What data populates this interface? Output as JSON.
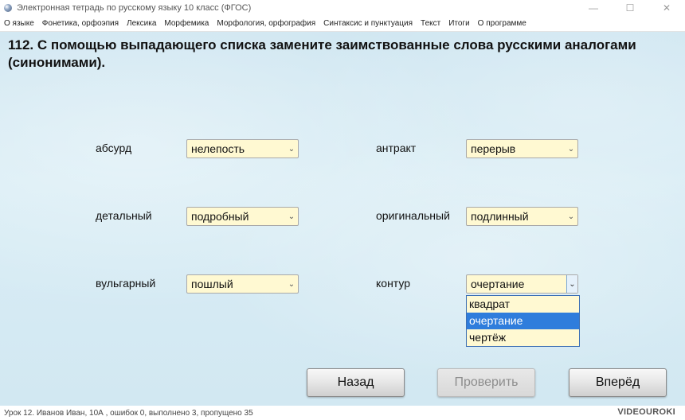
{
  "window": {
    "title": "Электронная тетрадь по русскому языку 10 класс (ФГОС)",
    "minimize": "—",
    "maximize": "☐",
    "close": "✕"
  },
  "menu": [
    "О языке",
    "Фонетика, орфоэпия",
    "Лексика",
    "Морфемика",
    "Морфология, орфография",
    "Синтаксис и пунктуация",
    "Текст",
    "Итоги",
    "О программе"
  ],
  "task": {
    "title": "112. С помощью выпадающего списка замените заимствованные слова русскими аналогами (синонимами)."
  },
  "pairs": [
    {
      "word": "абсурд",
      "value": "нелепость"
    },
    {
      "word": "антракт",
      "value": "перерыв"
    },
    {
      "word": "детальный",
      "value": "подробный"
    },
    {
      "word": "оригинальный",
      "value": "подлинный"
    },
    {
      "word": "вульгарный",
      "value": "пошлый"
    },
    {
      "word": "контур",
      "value": "очертание"
    }
  ],
  "dropdown": {
    "options": [
      "квадрат",
      "очертание",
      "чертёж"
    ],
    "selected_index": 1
  },
  "buttons": {
    "back": "Назад",
    "check": "Проверить",
    "next": "Вперёд"
  },
  "status": {
    "text": "Урок 12. Иванов Иван, 10А , ошибок 0, выполнено 3, пропущено 35",
    "logo": "VIDEOUROKI"
  },
  "icons": {
    "select_arrow": "chevron-down-icon",
    "app": "app-globe-icon"
  }
}
